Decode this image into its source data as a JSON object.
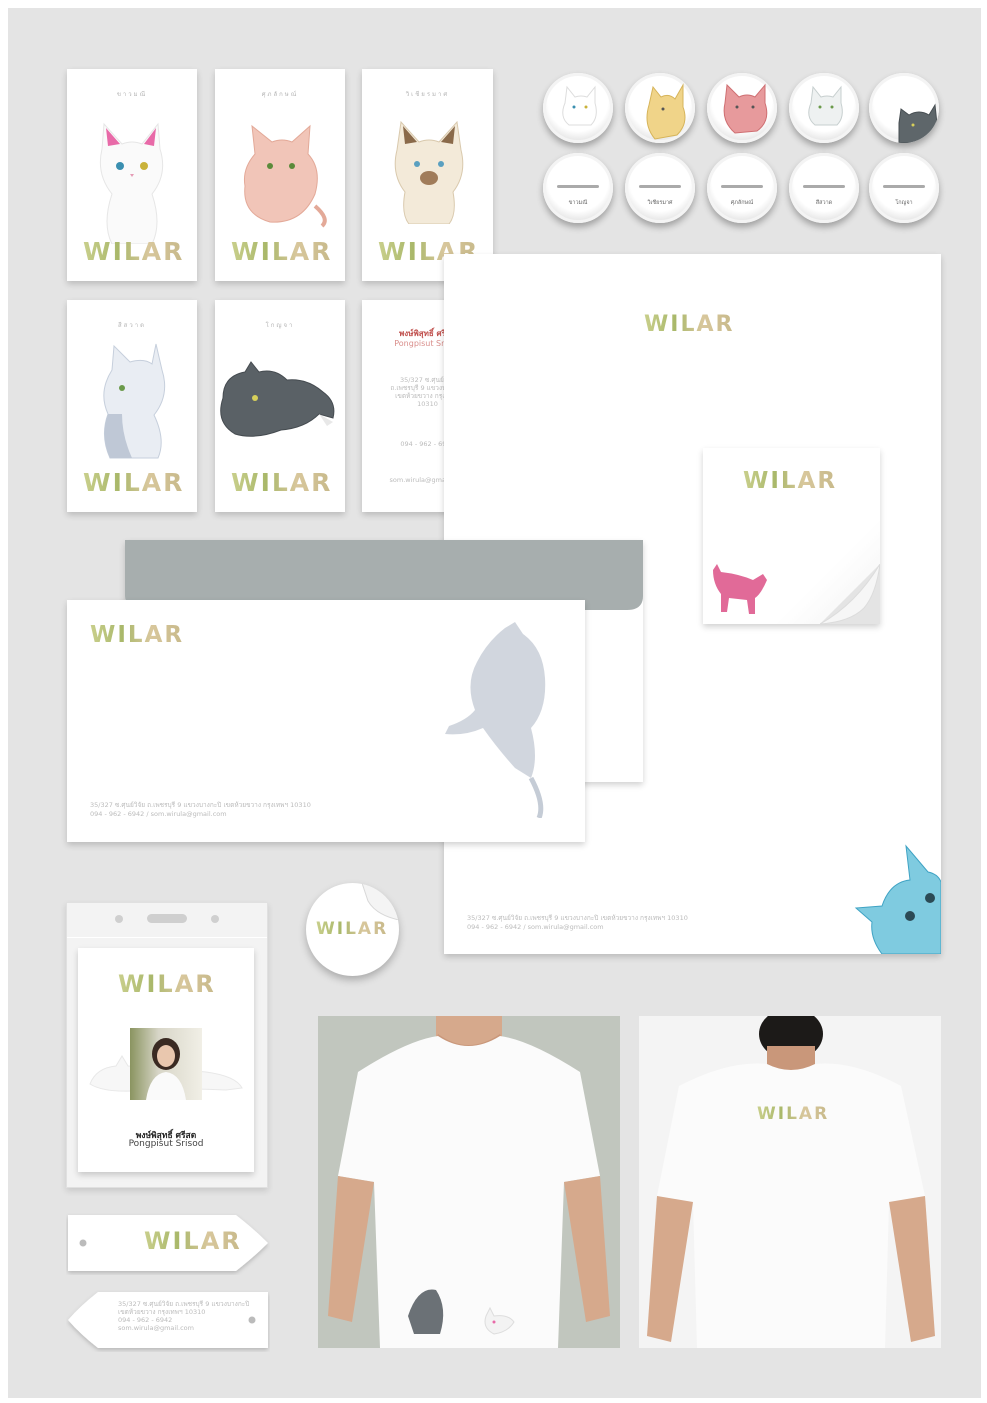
{
  "brand": "WILAR",
  "business_cards": [
    {
      "label": "ขาวมณี"
    },
    {
      "label": "ศุภลักษณ์"
    },
    {
      "label": "วิเชียรมาศ"
    },
    {
      "label": "สีสวาด"
    },
    {
      "label": "โกญจา"
    }
  ],
  "contact": {
    "name_th": "พงษ์พิสุทธิ์ ศรีสด",
    "name_en": "Pongpisut Srisod",
    "address_lines": [
      "35/327 ซ.ศุนย์วิจัย",
      "ถ.เพชรบุรี 9 แขวงบางกะปิ",
      "เขตห้วยขวาง กรุงเทพฯ",
      "10310"
    ],
    "phone": "094 - 962 - 6942",
    "email": "som.wirula@gmail.com",
    "address_full": "35/327 ซ.ศุนย์วิจัย ถ.เพชรบุรี 9 แขวงบางกะปิ เขตห้วยขวาง กรุงเทพฯ 10310",
    "phone_email": "094 - 962 - 6942  /  som.wirula@gmail.com"
  },
  "badges": [
    {
      "label": "ขาวมณี"
    },
    {
      "label": "วิเชียรมาศ"
    },
    {
      "label": "ศุภลักษณ์"
    },
    {
      "label": "สีสวาด"
    },
    {
      "label": "โกญจา"
    }
  ],
  "tag_back": {
    "lines": [
      "35/327 ซ.ศุนย์วิจัย ถ.เพชรบุรี 9 แขวงบางกะปิ",
      "เขตห้วยขวาง กรุงเทพฯ 10310",
      "094 - 962 - 6942",
      "som.wirula@gmail.com"
    ]
  },
  "colors": {
    "background": "#e4e4e4",
    "envelope_flap": "#a7aeae",
    "contact_name": "#c0504d"
  }
}
